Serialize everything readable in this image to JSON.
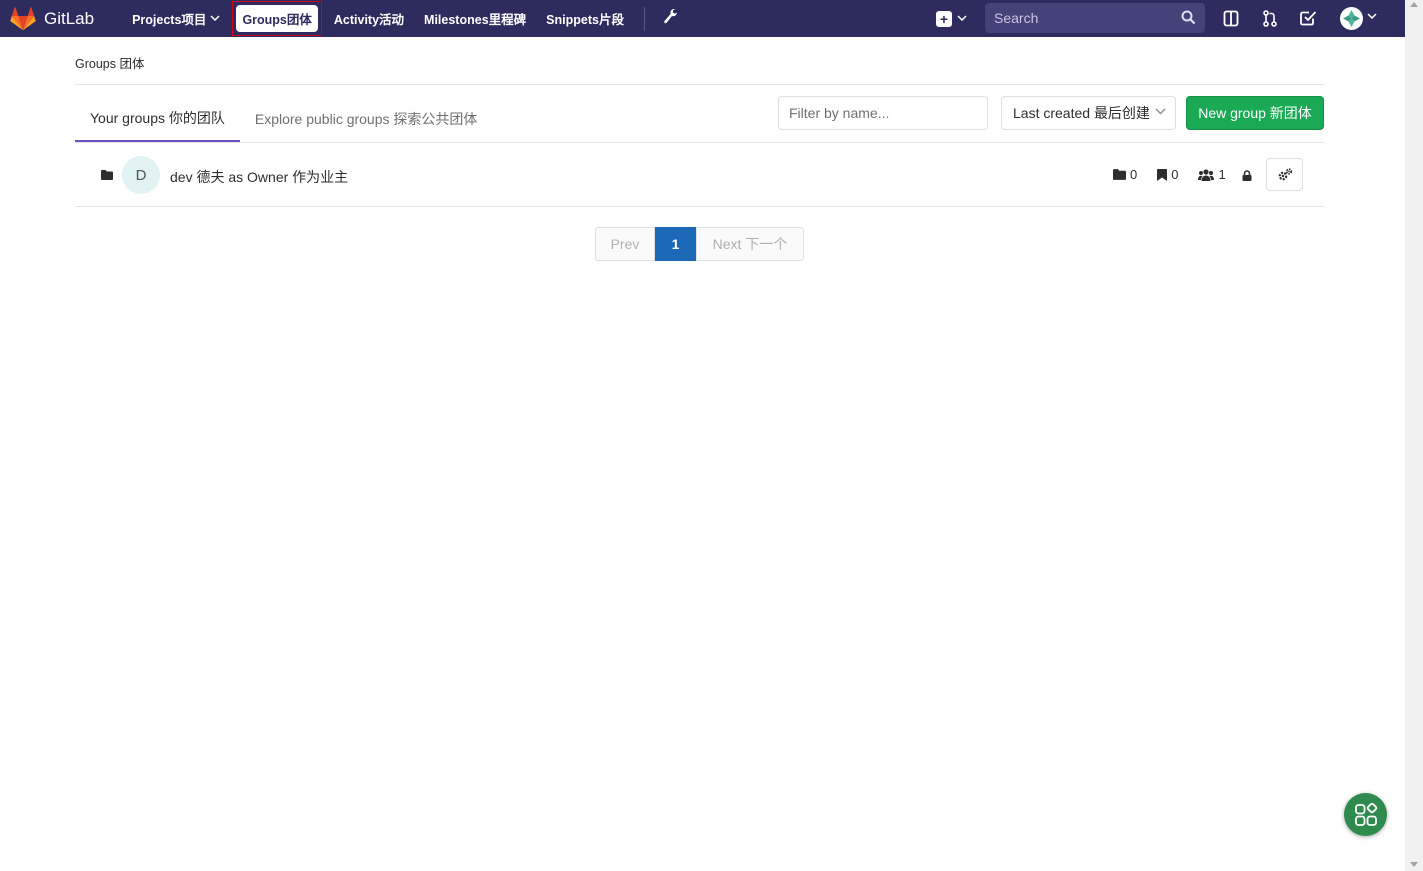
{
  "navbar": {
    "brand": "GitLab",
    "links": [
      {
        "label": "Projects项目",
        "has_dropdown": true
      },
      {
        "label": "Groups团体",
        "active": true
      },
      {
        "label": "Activity活动"
      },
      {
        "label": "Milestones里程碑"
      },
      {
        "label": "Snippets片段"
      }
    ],
    "search_placeholder": "Search",
    "icons": [
      "gitlab-logo-icon",
      "wrench-icon",
      "plus-square-icon",
      "search-icon",
      "sidebar-toggle-icon",
      "merge-request-icon",
      "todo-check-icon",
      "user-avatar"
    ],
    "background": "#2e2b5e"
  },
  "breadcrumb": "Groups 团体",
  "tabs": [
    {
      "label": "Your groups 你的团队",
      "active": true
    },
    {
      "label": "Explore public groups 探索公共团体",
      "active": false
    }
  ],
  "filter": {
    "placeholder": "Filter by name..."
  },
  "sort": {
    "selected": "Last created 最后创建"
  },
  "new_group_button": "New group 新团体",
  "groups": [
    {
      "avatar_letter": "D",
      "name": "dev 德夫 as Owner 作为业主",
      "subgroups": "0",
      "projects": "0",
      "members": "1",
      "visibility": "private"
    }
  ],
  "pagination": {
    "prev": "Prev",
    "current": "1",
    "next": "Next 下一个"
  },
  "colors": {
    "accent": "#6b4fbb",
    "success": "#1aaa55",
    "page_active": "#1b69b6"
  }
}
